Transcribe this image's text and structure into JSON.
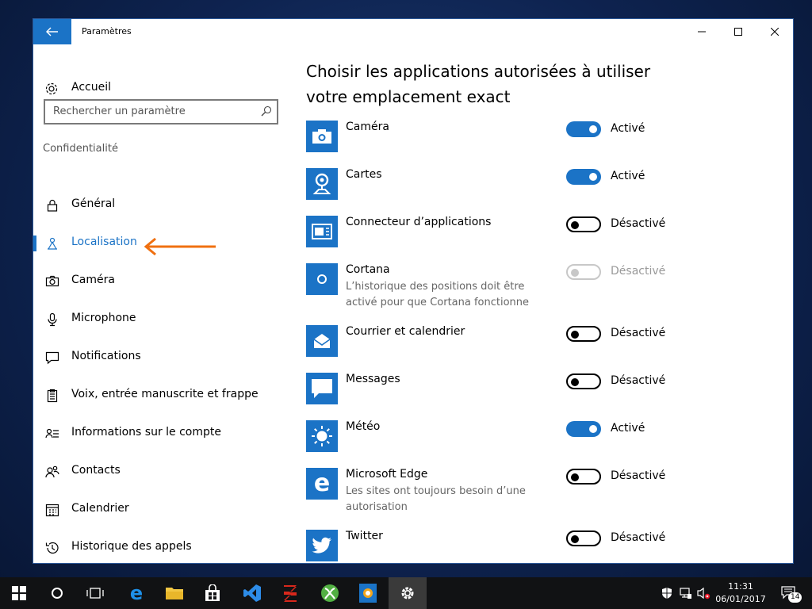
{
  "window": {
    "title": "Paramètres"
  },
  "sidebar": {
    "home_label": "Accueil",
    "search_placeholder": "Rechercher un paramètre",
    "section_title": "Confidentialité",
    "items": [
      {
        "label": "Général",
        "icon": "lock-icon",
        "active": false
      },
      {
        "label": "Localisation",
        "icon": "location-icon",
        "active": true
      },
      {
        "label": "Caméra",
        "icon": "camera-icon",
        "active": false
      },
      {
        "label": "Microphone",
        "icon": "microphone-icon",
        "active": false
      },
      {
        "label": "Notifications",
        "icon": "notification-icon",
        "active": false
      },
      {
        "label": "Voix, entrée manuscrite et frappe",
        "icon": "clipboard-icon",
        "active": false
      },
      {
        "label": "Informations sur le compte",
        "icon": "account-info-icon",
        "active": false
      },
      {
        "label": "Contacts",
        "icon": "contacts-icon",
        "active": false
      },
      {
        "label": "Calendrier",
        "icon": "calendar-icon",
        "active": false
      },
      {
        "label": "Historique des appels",
        "icon": "history-icon",
        "active": false
      }
    ]
  },
  "main": {
    "heading": "Choisir les applications autorisées à utiliser votre emplacement exact",
    "apps": [
      {
        "name": "Caméra",
        "desc": "",
        "state": "Activé",
        "toggle": "on",
        "icon": "camera-app-icon"
      },
      {
        "name": "Cartes",
        "desc": "",
        "state": "Activé",
        "toggle": "on",
        "icon": "maps-app-icon"
      },
      {
        "name": "Connecteur d’applications",
        "desc": "",
        "state": "Désactivé",
        "toggle": "off",
        "icon": "app-connector-icon"
      },
      {
        "name": "Cortana",
        "desc": "L’historique des positions doit être activé pour que Cortana fonctionne",
        "state": "Désactivé",
        "toggle": "disabled",
        "icon": "cortana-icon"
      },
      {
        "name": "Courrier et calendrier",
        "desc": "",
        "state": "Désactivé",
        "toggle": "off",
        "icon": "mail-calendar-icon"
      },
      {
        "name": "Messages",
        "desc": "",
        "state": "Désactivé",
        "toggle": "off",
        "icon": "messages-icon"
      },
      {
        "name": "Météo",
        "desc": "",
        "state": "Activé",
        "toggle": "on",
        "icon": "weather-icon"
      },
      {
        "name": "Microsoft Edge",
        "desc": "Les sites ont toujours besoin d’une autorisation",
        "state": "Désactivé",
        "toggle": "off",
        "icon": "edge-icon"
      },
      {
        "name": "Twitter",
        "desc": "",
        "state": "Désactivé",
        "toggle": "off",
        "icon": "twitter-icon"
      }
    ]
  },
  "taskbar": {
    "time": "11:31",
    "date": "06/01/2017",
    "notification_count": "14"
  },
  "colors": {
    "accent": "#1b73c6",
    "annotation_arrow": "#f07010",
    "taskbar": "#111214"
  }
}
